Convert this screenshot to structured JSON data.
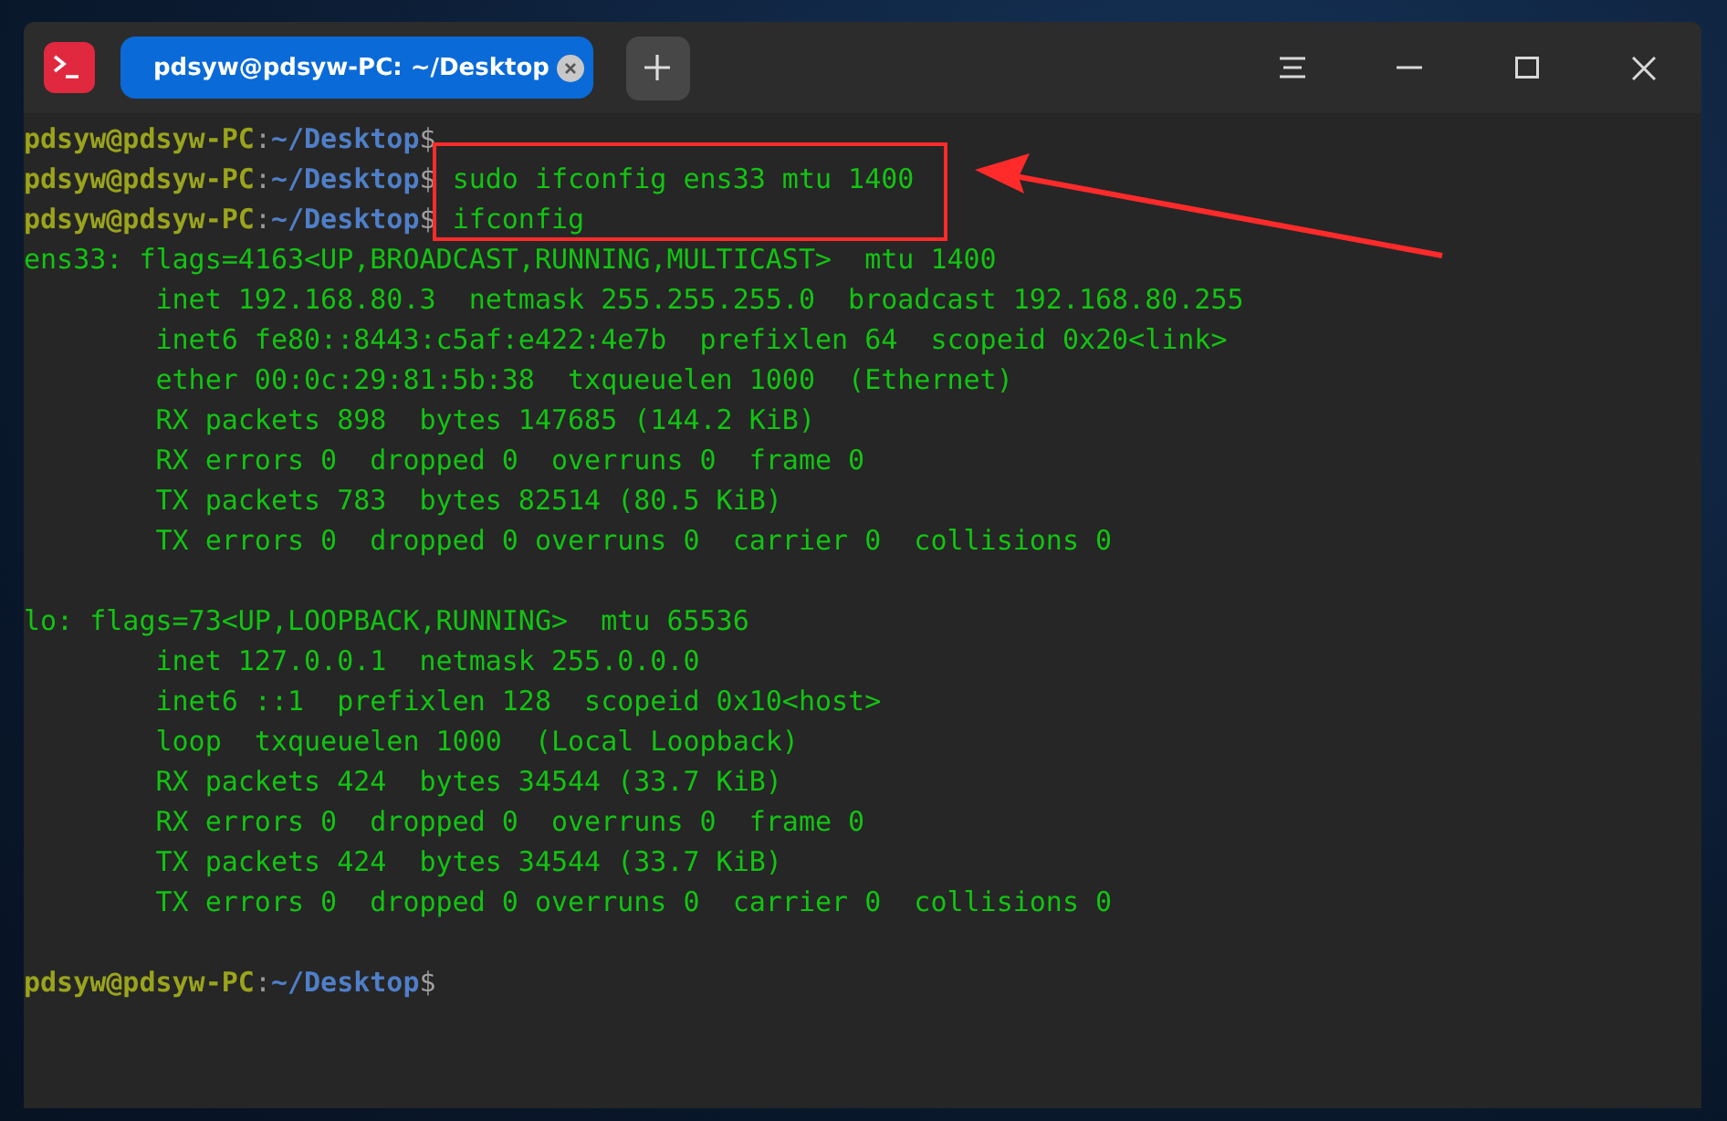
{
  "window": {
    "tabs": [
      {
        "label": "pdsyw@pdsyw-PC: ~/Desktop",
        "selected": true
      }
    ]
  },
  "terminal": {
    "lines": [
      {
        "kind": "prompt",
        "user_host": "pdsyw@pdsyw-PC",
        "separator": ":",
        "path": "~/Desktop",
        "prompt_char": "$"
      },
      {
        "kind": "prompt",
        "user_host": "pdsyw@pdsyw-PC",
        "separator": ":",
        "path": "~/Desktop",
        "prompt_char": "$",
        "command": "sudo ifconfig ens33 mtu 1400"
      },
      {
        "kind": "prompt",
        "user_host": "pdsyw@pdsyw-PC",
        "separator": ":",
        "path": "~/Desktop",
        "prompt_char": "$",
        "command": "ifconfig"
      },
      {
        "kind": "output",
        "text": "ens33: flags=4163<UP,BROADCAST,RUNNING,MULTICAST>  mtu 1400"
      },
      {
        "kind": "output",
        "text": "        inet 192.168.80.3  netmask 255.255.255.0  broadcast 192.168.80.255"
      },
      {
        "kind": "output",
        "text": "        inet6 fe80::8443:c5af:e422:4e7b  prefixlen 64  scopeid 0x20<link>"
      },
      {
        "kind": "output",
        "text": "        ether 00:0c:29:81:5b:38  txqueuelen 1000  (Ethernet)"
      },
      {
        "kind": "output",
        "text": "        RX packets 898  bytes 147685 (144.2 KiB)"
      },
      {
        "kind": "output",
        "text": "        RX errors 0  dropped 0  overruns 0  frame 0"
      },
      {
        "kind": "output",
        "text": "        TX packets 783  bytes 82514 (80.5 KiB)"
      },
      {
        "kind": "output",
        "text": "        TX errors 0  dropped 0 overruns 0  carrier 0  collisions 0"
      },
      {
        "kind": "blank"
      },
      {
        "kind": "output",
        "text": "lo: flags=73<UP,LOOPBACK,RUNNING>  mtu 65536"
      },
      {
        "kind": "output",
        "text": "        inet 127.0.0.1  netmask 255.0.0.0"
      },
      {
        "kind": "output",
        "text": "        inet6 ::1  prefixlen 128  scopeid 0x10<host>"
      },
      {
        "kind": "output",
        "text": "        loop  txqueuelen 1000  (Local Loopback)"
      },
      {
        "kind": "output",
        "text": "        RX packets 424  bytes 34544 (33.7 KiB)"
      },
      {
        "kind": "output",
        "text": "        RX errors 0  dropped 0  overruns 0  frame 0"
      },
      {
        "kind": "output",
        "text": "        TX packets 424  bytes 34544 (33.7 KiB)"
      },
      {
        "kind": "output",
        "text": "        TX errors 0  dropped 0 overruns 0  carrier 0  collisions 0"
      },
      {
        "kind": "blank"
      },
      {
        "kind": "prompt",
        "user_host": "pdsyw@pdsyw-PC",
        "separator": ":",
        "path": "~/Desktop",
        "prompt_char": "$"
      }
    ]
  }
}
